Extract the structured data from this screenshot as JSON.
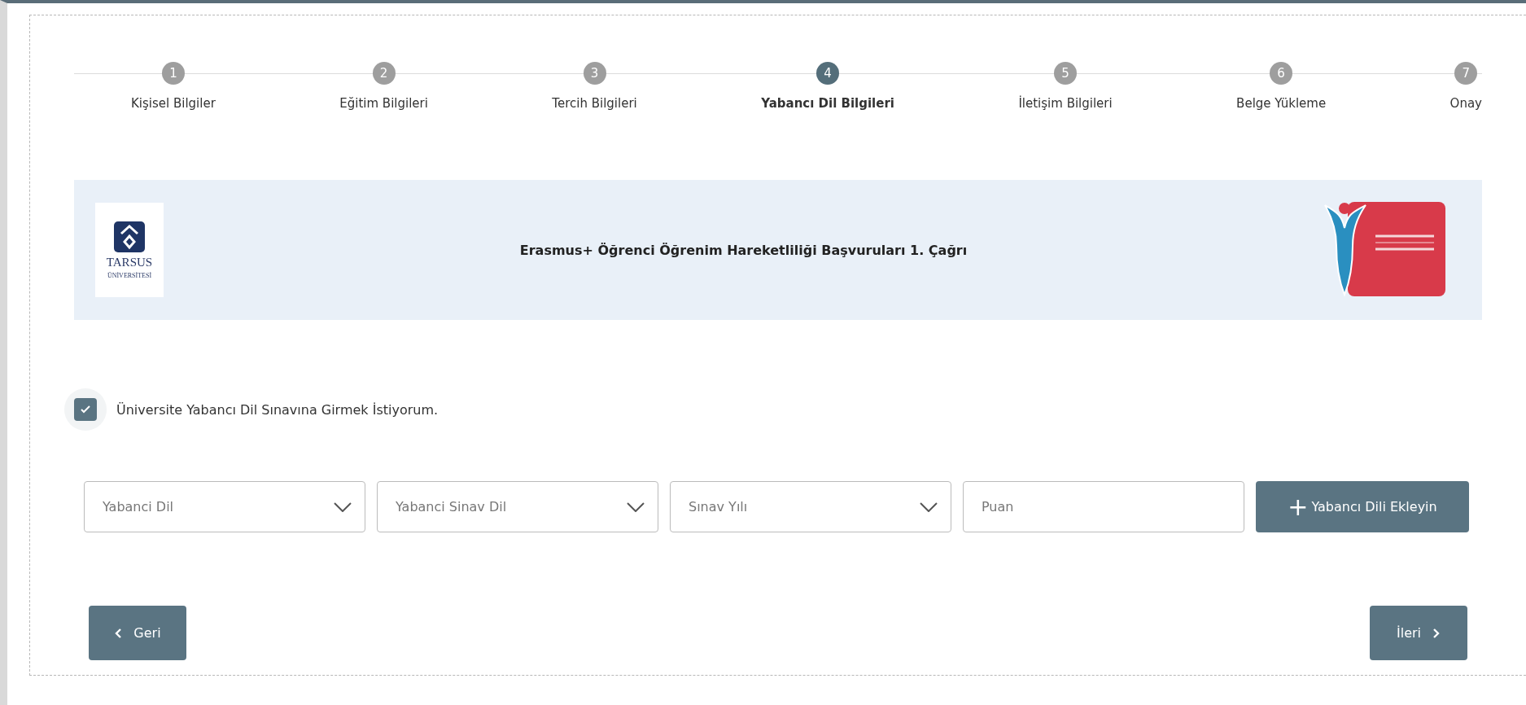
{
  "steps": [
    {
      "number": "1",
      "label": "Kişisel Bilgiler",
      "selected": false
    },
    {
      "number": "2",
      "label": "Eğitim Bilgileri",
      "selected": false
    },
    {
      "number": "3",
      "label": "Tercih Bilgileri",
      "selected": false
    },
    {
      "number": "4",
      "label": "Yabancı Dil Bilgileri",
      "selected": true
    },
    {
      "number": "5",
      "label": "İletişim Bilgileri",
      "selected": false
    },
    {
      "number": "6",
      "label": "Belge Yükleme",
      "selected": false
    },
    {
      "number": "7",
      "label": "Onay",
      "selected": false
    }
  ],
  "banner": {
    "logo_left": {
      "name": "TARSUS",
      "subtitle": "ÜNİVERSİTESİ"
    },
    "title": "Erasmus+ Öğrenci Öğrenim Hareketliliği Başvuruları 1. Çağrı"
  },
  "consent": {
    "label": "Üniversite Yabancı Dil Sınavına Girmek İstiyorum.",
    "checked": true
  },
  "fields": [
    {
      "kind": "select",
      "placeholder": "Yabanci Dil"
    },
    {
      "kind": "select",
      "placeholder": "Yabanci Sinav Dil"
    },
    {
      "kind": "select",
      "placeholder": "Sınav Yılı"
    },
    {
      "kind": "input",
      "placeholder": "Puan"
    }
  ],
  "add_button": {
    "icon": "+",
    "label": "Yabancı Dili Ekleyin"
  },
  "nav": {
    "back": "Geri",
    "next": "İleri"
  }
}
